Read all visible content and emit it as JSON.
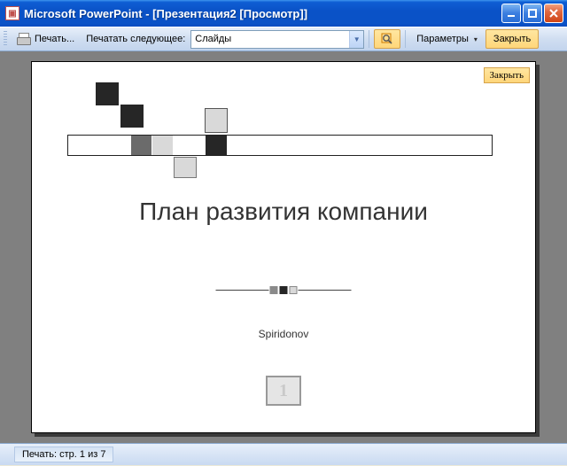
{
  "window": {
    "title": "Microsoft PowerPoint - [Презентация2 [Просмотр]]"
  },
  "toolbar": {
    "print_label": "Печать...",
    "print_what_label": "Печатать следующее:",
    "print_what_value": "Слайды",
    "options_label": "Параметры",
    "close_label": "Закрыть"
  },
  "preview": {
    "overlay_close_label": "Закрыть",
    "slide": {
      "title": "План развития компании",
      "author": "Spiridonov",
      "number": "1"
    }
  },
  "status": {
    "text": "Печать: стр. 1 из 7"
  },
  "colors": {
    "sq_dark": "#262626",
    "sq_mid": "#6b6b6b",
    "sq_light": "#d9d9d9"
  }
}
